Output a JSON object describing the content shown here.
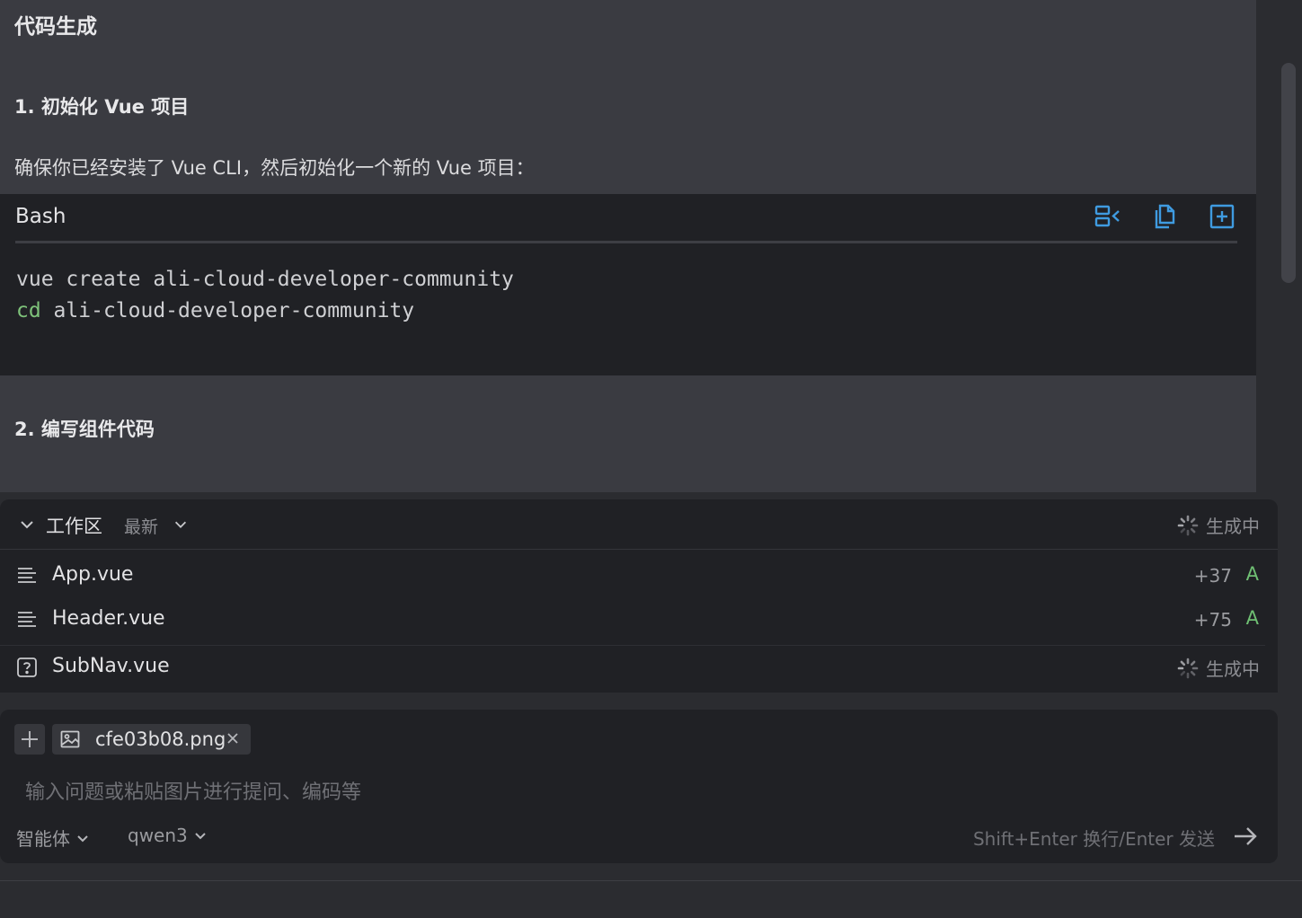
{
  "chat": {
    "title": "代码生成",
    "step1_heading": "1. 初始化 Vue 项目",
    "step1_text": "确保你已经安装了 Vue CLI，然后初始化一个新的 Vue 项目：",
    "code": {
      "language": "Bash",
      "line1": "vue create ali-cloud-developer-community",
      "line2_kw": "cd",
      "line2_rest": " ali-cloud-developer-community",
      "tool_icons": [
        "insert-icon",
        "copy-icon",
        "new-file-icon"
      ]
    },
    "step2_heading": "2. 编写组件代码"
  },
  "workspace": {
    "title": "工作区",
    "filter": "最新",
    "status": "生成中",
    "files": [
      {
        "name": "App.vue",
        "count": "+37",
        "badge": "A",
        "icon": "file-lines-icon"
      },
      {
        "name": "Header.vue",
        "count": "+75",
        "badge": "A",
        "icon": "file-lines-icon"
      },
      {
        "name": "SubNav.vue",
        "status": "生成中",
        "icon": "unknown-file-icon"
      }
    ]
  },
  "input": {
    "attachment": "cfe03b08.png",
    "placeholder": "输入问题或粘贴图片进行提问、编码等",
    "agent_label": "智能体",
    "model_label": "qwen3",
    "hint": "Shift+Enter 换行/Enter 发送"
  },
  "colors": {
    "chat_bg": "#3a3b41",
    "panel_bg": "#202125",
    "accent_blue": "#3f9be0",
    "added_green": "#6fbf73"
  }
}
